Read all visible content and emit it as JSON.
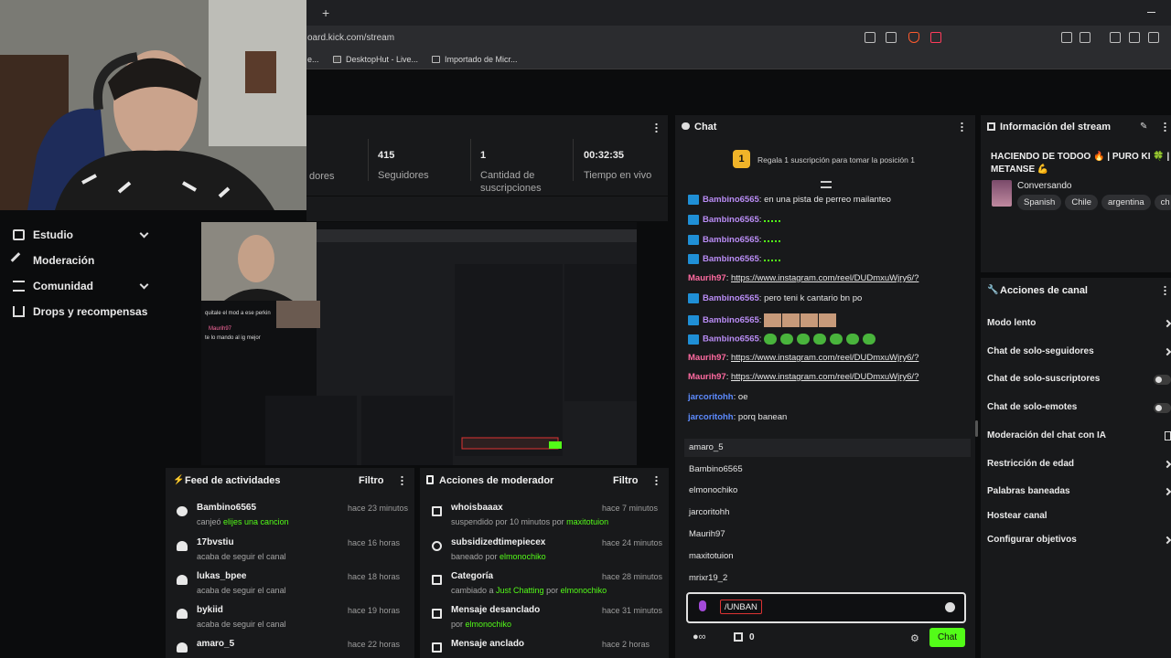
{
  "browser": {
    "url": "oard.kick.com/stream",
    "new_tab": "+",
    "bookmarks": [
      {
        "label": "e..."
      },
      {
        "label": "DesktopHut - Live..."
      },
      {
        "label": "Importado de Micr..."
      }
    ]
  },
  "sidebar": {
    "items": [
      {
        "label": "Estudio"
      },
      {
        "label": "Moderación"
      },
      {
        "label": "Comunidad"
      },
      {
        "label": "Drops y recompensas"
      }
    ]
  },
  "stats": {
    "items": [
      {
        "value": "",
        "label": "dores"
      },
      {
        "value": "415",
        "label": "Seguidores"
      },
      {
        "value": "1",
        "label": "Cantidad de suscripciones"
      },
      {
        "value": "00:32:35",
        "label": "Tiempo en vivo"
      }
    ]
  },
  "preview": {
    "cam_user": "Maurih97",
    "cam_msg": "te lo mando al ig mejor",
    "cam_line1": "quitale el mod a ese perkin"
  },
  "activity_feed": {
    "title": "Feed de actividades",
    "filter": "Filtro",
    "items": [
      {
        "user": "Bambino6565",
        "text": "canjeó ",
        "highlight": "elijes una cancion",
        "time": "hace 23 minutos",
        "icon": "redeem-icon"
      },
      {
        "user": "17bvstiu",
        "text": "acaba de seguir el canal",
        "highlight": "",
        "time": "hace 16 horas",
        "icon": "heart-icon"
      },
      {
        "user": "lukas_bpee",
        "text": "acaba de seguir el canal",
        "highlight": "",
        "time": "hace 18 horas",
        "icon": "heart-icon"
      },
      {
        "user": "bykiid",
        "text": "acaba de seguir el canal",
        "highlight": "",
        "time": "hace 19 horas",
        "icon": "heart-icon"
      },
      {
        "user": "amaro_5",
        "text": "",
        "highlight": "",
        "time": "hace 22 horas",
        "icon": "heart-icon"
      }
    ]
  },
  "mod_actions": {
    "title": "Acciones de moderador",
    "filter": "Filtro",
    "items": [
      {
        "title": "whoisbaaax",
        "pre": "suspendido por 10 minutos por ",
        "mid": "",
        "by": "maxitotuion",
        "time": "hace 7 minutos",
        "icon": "hourglass-icon"
      },
      {
        "title": "subsidizedtimepiecex",
        "pre": "baneado por ",
        "mid": "",
        "by": "elmonochiko",
        "time": "hace 24 minutos",
        "icon": "ban-icon"
      },
      {
        "title": "Categoría",
        "pre": "cambiado a ",
        "mid": "Just Chatting",
        "by": "elmonochiko",
        "time": "hace 28 minutos",
        "icon": "category-icon"
      },
      {
        "title": "Mensaje desanclado",
        "pre": "por ",
        "mid": "",
        "by": "elmonochiko",
        "time": "hace 31 minutos",
        "icon": "unpin-icon"
      },
      {
        "title": "Mensaje anclado",
        "pre": "",
        "mid": "",
        "by": "",
        "time": "hace 2 horas",
        "icon": "pin-icon"
      }
    ],
    "by_word": " por "
  },
  "chat": {
    "title": "Chat",
    "promo_badge": "1",
    "promo": "Regala 1 suscripción para tomar la posición 1",
    "messages": [
      {
        "user": "Bambino6565",
        "text": "en una pista de perreo mailanteo",
        "type": "b"
      },
      {
        "user": "Bambino6565",
        "text": "",
        "type": "b"
      },
      {
        "user": "Bambino6565",
        "text": "",
        "type": "b"
      },
      {
        "user": "Bambino6565",
        "text": "",
        "type": "b"
      },
      {
        "user": "Maurih97",
        "text": "https://www.instagram.com/reel/DUDmxuWjry6/?",
        "type": "r"
      },
      {
        "user": "Bambino6565",
        "text": "pero teni k cantario bn po",
        "type": "b"
      },
      {
        "user": "Bambino6565",
        "text": "",
        "type": "b"
      },
      {
        "user": "Bambino6565",
        "text": "",
        "type": "b"
      },
      {
        "user": "Maurih97",
        "text": "https://www.instagram.com/reel/DUDmxuWjry6/?",
        "type": "r"
      },
      {
        "user": "Maurih97",
        "text": "https://www.instagram.com/reel/DUDmxuWjry6/?",
        "type": "r"
      },
      {
        "user": "jarcoritohh",
        "text": "oe",
        "type": "p"
      },
      {
        "user": "jarcoritohh",
        "text": "porq banean",
        "type": "p"
      }
    ],
    "suggestions": [
      "amaro_5",
      "Bambino6565",
      "elmonochiko",
      "jarcoritohh",
      "Maurih97",
      "maxitotuion",
      "mrixr19_2"
    ],
    "input_value": "/UNBAN",
    "send": "Chat",
    "count": "0"
  },
  "stream_info": {
    "title": "Información del stream",
    "stream_title": "HACIENDO DE TODOO 🔥 | PURO KI 🍀 | METANSE 💪",
    "category": "Conversando",
    "tags": [
      "Spanish",
      "Chile",
      "argentina",
      "ch"
    ]
  },
  "channel_actions": {
    "title": "Acciones de canal",
    "items": [
      {
        "label": "Modo lento",
        "ctrl": "chevron"
      },
      {
        "label": "Chat de solo-seguidores",
        "ctrl": "chevron"
      },
      {
        "label": "Chat de solo-suscriptores",
        "ctrl": "toggle"
      },
      {
        "label": "Chat de solo-emotes",
        "ctrl": "toggle"
      },
      {
        "label": "Moderación del chat con IA",
        "ctrl": "icon"
      },
      {
        "label": "Restricción de edad",
        "ctrl": "chevron"
      },
      {
        "label": "Palabras baneadas",
        "ctrl": "chevron"
      },
      {
        "label": "Hostear canal",
        "ctrl": "none"
      },
      {
        "label": "Configurar objetivos",
        "ctrl": "chevron"
      }
    ]
  },
  "colors": {
    "kick_green": "#53fc18",
    "panel": "#18191b",
    "bg": "#0b0c0d"
  }
}
